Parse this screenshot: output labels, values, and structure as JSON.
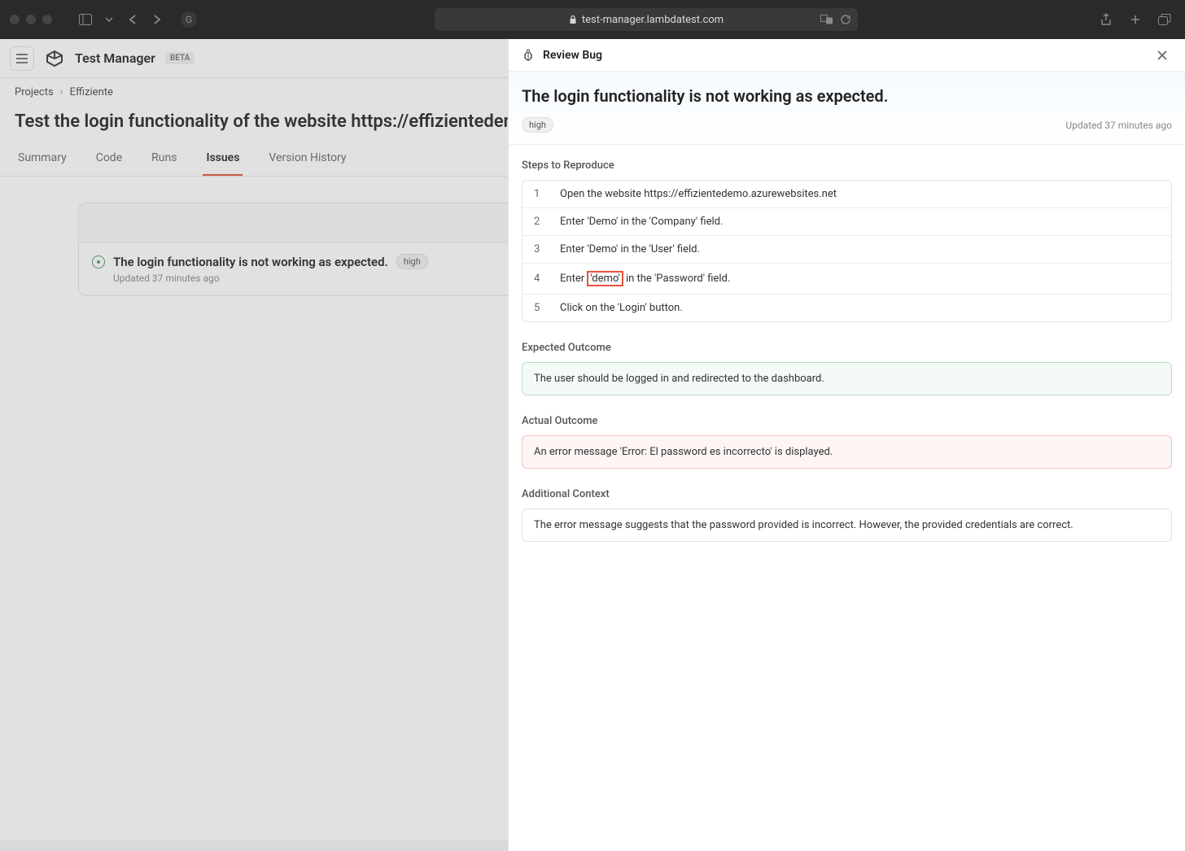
{
  "browser": {
    "url": "test-manager.lambdatest.com"
  },
  "app": {
    "title": "Test Manager",
    "badge": "BETA"
  },
  "breadcrumb": {
    "root": "Projects",
    "current": "Effiziente"
  },
  "page": {
    "title": "Test the login functionality of the website https://effizientedemo."
  },
  "tabs": [
    {
      "label": "Summary",
      "active": false
    },
    {
      "label": "Code",
      "active": false
    },
    {
      "label": "Runs",
      "active": false
    },
    {
      "label": "Issues",
      "active": true
    },
    {
      "label": "Version History",
      "active": false
    }
  ],
  "issue": {
    "title": "The login functionality is not working as expected.",
    "priority": "high",
    "updated": "Updated 37 minutes ago"
  },
  "panel": {
    "header": "Review Bug",
    "title": "The login functionality is not working as expected.",
    "priority": "high",
    "updated": "Updated 37 minutes ago",
    "steps_label": "Steps to Reproduce",
    "steps": [
      {
        "n": "1",
        "text": "Open the website https://effizientedemo.azurewebsites.net"
      },
      {
        "n": "2",
        "text": "Enter 'Demo' in the 'Company' field."
      },
      {
        "n": "3",
        "text": "Enter 'Demo' in the 'User' field."
      },
      {
        "n": "4",
        "pre": "Enter ",
        "hl": "'demo'",
        "post": " in the 'Password' field."
      },
      {
        "n": "5",
        "text": "Click on the 'Login' button."
      }
    ],
    "expected_label": "Expected Outcome",
    "expected": "The user should be logged in and redirected to the dashboard.",
    "actual_label": "Actual Outcome",
    "actual": "An error message 'Error: El password es incorrecto' is displayed.",
    "additional_label": "Additional Context",
    "additional": "The error message suggests that the password provided is incorrect. However, the provided credentials are correct."
  }
}
